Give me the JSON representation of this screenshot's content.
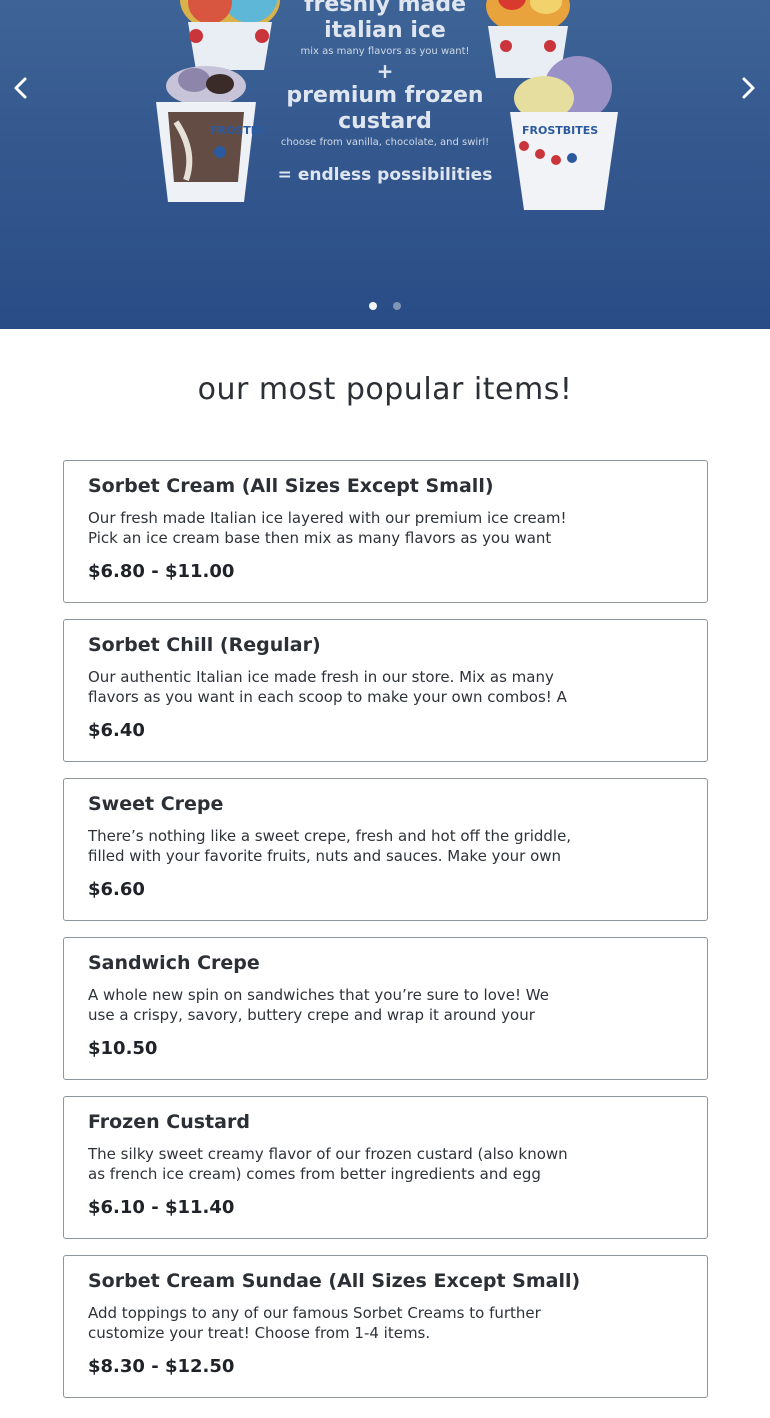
{
  "hero": {
    "line1": "freshly made",
    "line2": "italian ice",
    "line3": "mix as many flavors as you want!",
    "plus": "+",
    "line4": "premium frozen",
    "line5": "custard",
    "line6": "choose from vanilla, chocolate, and swirl!",
    "line7": "= endless possibilities",
    "cup_brand": "FROSTBITES",
    "slides_total": 2,
    "active_slide": 1,
    "prev_icon": "chevron-left-icon",
    "next_icon": "chevron-right-icon"
  },
  "section": {
    "title": "our most popular items!"
  },
  "items": [
    {
      "name": "Sorbet Cream (All Sizes Except Small)",
      "description": "Our fresh made Italian ice layered with our premium ice cream! Pick an ice cream base then mix as many flavors as you want on top and...",
      "price": "$6.80 - $11.00"
    },
    {
      "name": "Sorbet Chill (Regular)",
      "description": "Our authentic Italian ice made fresh in our store. Mix as many flavors as you want in each scoop to make your own combos! A regular has ...",
      "price": "$6.40"
    },
    {
      "name": "Sweet Crepe",
      "description": "There’s nothing like a sweet crepe, fresh and hot off the griddle, filled with your favorite fruits, nuts and sauces. Make your own creation...",
      "price": "$6.60"
    },
    {
      "name": "Sandwich Crepe",
      "description": "A whole new spin on sandwiches that you’re sure to love! We use a crispy, savory, buttery crepe and wrap it around your choice of meat...",
      "price": "$10.50"
    },
    {
      "name": "Frozen Custard",
      "description": "The silky sweet creamy flavor of our frozen custard (also known as french ice cream) comes from better ingredients and egg yolk. Trea...",
      "price": "$6.10 - $11.40"
    },
    {
      "name": "Sorbet Cream Sundae (All Sizes Except Small)",
      "description": "Add toppings to any of our famous Sorbet Creams to further customize your treat! Choose from 1-4 items.",
      "price": "$8.30 - $12.50"
    }
  ],
  "colors": {
    "hero_top": "#3e6497",
    "hero_bottom": "#294c86",
    "text": "#2b2f36",
    "card_border": "#8f959c"
  }
}
